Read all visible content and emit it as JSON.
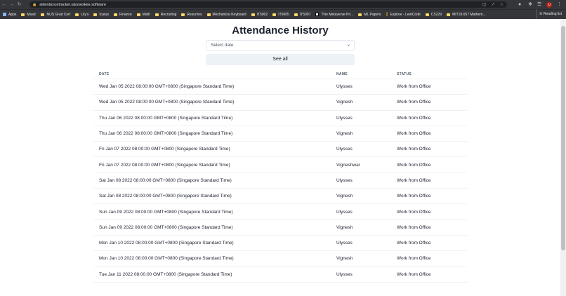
{
  "browser": {
    "url": "attendancetracker.ulysseskee.software",
    "bookmarks": [
      "Apps",
      "Music",
      "NUS Grad Cert",
      "Lily's",
      "Icarus",
      "Finance",
      "Math",
      "Recruiting",
      "Resumes",
      "Mechanical Keyboard",
      "IT5002",
      "IT5005",
      "IT5007",
      "'The Metaverse Pri...",
      "ML Papers",
      "Explore - LeetCode",
      "CS229",
      "MIT18.657 Mathem..."
    ],
    "reading_list": "Reading list",
    "avatar_letter": "U"
  },
  "page": {
    "title": "Attendance History",
    "select_placeholder": "Select date",
    "see_all_label": "See all",
    "columns": [
      "DATE",
      "NAME",
      "STATUS"
    ],
    "rows": [
      {
        "date": "Wed Jan 05 2022 08:00:00 GMT+0800 (Singapore Standard Time)",
        "name": "Ulysses",
        "status": "Work from Office"
      },
      {
        "date": "Wed Jan 05 2022 08:00:00 GMT+0800 (Singapore Standard Time)",
        "name": "Vignesh",
        "status": "Work from Office"
      },
      {
        "date": "Thu Jan 06 2022 08:00:00 GMT+0800 (Singapore Standard Time)",
        "name": "Ulysses",
        "status": "Work from Office"
      },
      {
        "date": "Thu Jan 06 2022 08:00:00 GMT+0800 (Singapore Standard Time)",
        "name": "Vignesh",
        "status": "Work from Office"
      },
      {
        "date": "Fri Jan 07 2022 08:00:00 GMT+0800 (Singapore Standard Time)",
        "name": "Ulysses",
        "status": "Work from Office"
      },
      {
        "date": "Fri Jan 07 2022 08:00:00 GMT+0800 (Singapore Standard Time)",
        "name": "Vigneshwar",
        "status": "Work from Office"
      },
      {
        "date": "Sat Jan 08 2022 08:00:00 GMT+0800 (Singapore Standard Time)",
        "name": "Ulysses",
        "status": "Work from Office"
      },
      {
        "date": "Sat Jan 08 2022 08:00:00 GMT+0800 (Singapore Standard Time)",
        "name": "Vignesh",
        "status": "Work from Office"
      },
      {
        "date": "Sun Jan 09 2022 08:00:00 GMT+0800 (Singapore Standard Time)",
        "name": "Ulysses",
        "status": "Work from Office"
      },
      {
        "date": "Sun Jan 09 2022 08:00:00 GMT+0800 (Singapore Standard Time)",
        "name": "Vignesh",
        "status": "Work from Office"
      },
      {
        "date": "Mon Jan 10 2022 08:00:00 GMT+0800 (Singapore Standard Time)",
        "name": "Ulysses",
        "status": "Work from Office"
      },
      {
        "date": "Mon Jan 10 2022 08:00:00 GMT+0800 (Singapore Standard Time)",
        "name": "Vignesh",
        "status": "Work from Office"
      },
      {
        "date": "Tue Jan 11 2022 08:00:00 GMT+0800 (Singapore Standard Time)",
        "name": "Ulysses",
        "status": "Work from Office"
      }
    ]
  }
}
